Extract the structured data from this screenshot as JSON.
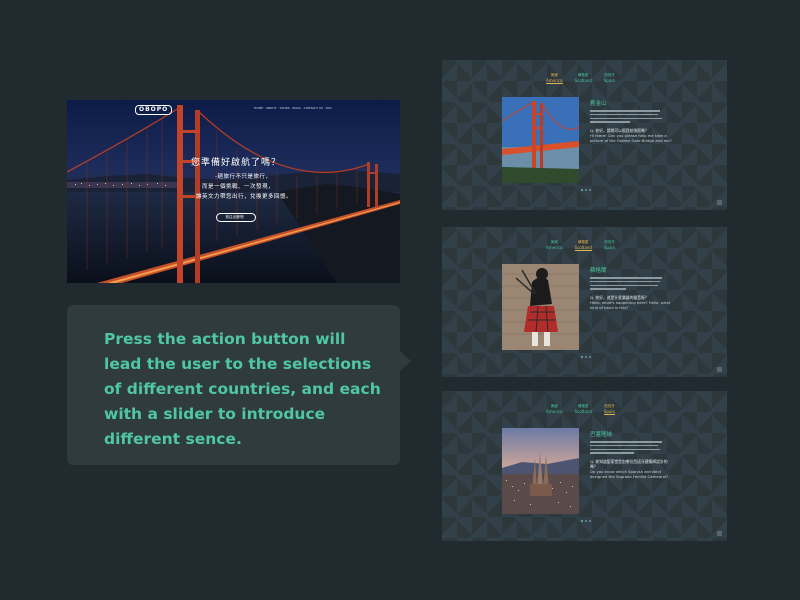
{
  "hero": {
    "logo": "OBOPO",
    "nav": "HOME · ABOUT · TOURS · BLOG · CONTACT US · FAQ",
    "headline": "您準備好啟航了嗎？",
    "sub_line_1": "-趟旅行不只是旅行，",
    "sub_line_2": "而是一個挑戰、一次發現，",
    "sub_line_3": "讓英文力帶您出行，兌換更多回憶。",
    "cta": "前往出發吧！"
  },
  "callout": {
    "message": "Press the action button will lead the user to the selections of different countries, and each with a slider to introduce different sence."
  },
  "panels": [
    {
      "tabs": [
        {
          "zh": "美國",
          "en": "America"
        },
        {
          "zh": "蘇格蘭",
          "en": "Scotland"
        },
        {
          "zh": "西班牙",
          "en": "Spain"
        }
      ],
      "active": "America",
      "title": "舊金山",
      "question_zh": "Q. 你好，請問可以幫我拍張照嗎？",
      "question_en": "Hi there! Can you please help me take a picture of the Golden Gate Bridge and me?"
    },
    {
      "tabs": [
        {
          "zh": "美國",
          "en": "America"
        },
        {
          "zh": "蘇格蘭",
          "en": "Scotland"
        },
        {
          "zh": "西班牙",
          "en": "Spain"
        }
      ],
      "active": "Scotland",
      "title": "蘇格蘭",
      "question_zh": "Q. 你好，這是什麼樂器的聲音呀？",
      "question_en": "Hello, what's happening here? Hello, what kind of band is this?"
    },
    {
      "tabs": [
        {
          "zh": "美國",
          "en": "America"
        },
        {
          "zh": "蘇格蘭",
          "en": "Scotland"
        },
        {
          "zh": "西班牙",
          "en": "Spain"
        }
      ],
      "active": "Spain",
      "title": "巴塞隆納",
      "question_zh": "Q. 你知道聖家堂是由哪位西班牙建築師設計的嗎？",
      "question_en": "Do you know which Spanish architect designed the Sagrada Familia Cathedral?"
    }
  ],
  "colors": {
    "background": "#212a2e",
    "accent": "#4fc7a3",
    "active_tab": "#e0b350",
    "callout_bg": "#303b40"
  }
}
